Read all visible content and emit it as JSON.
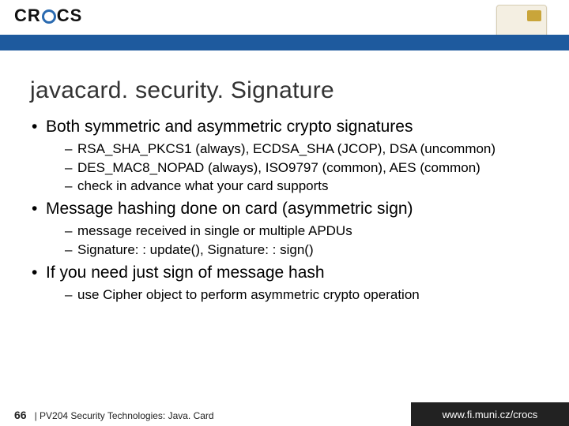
{
  "logo": {
    "text_before": "CR",
    "text_after": "CS"
  },
  "title": "javacard. security. Signature",
  "bullets": [
    {
      "text": "Both symmetric and asymmetric crypto signatures",
      "sub": [
        "RSA_SHA_PKCS1 (always), ECDSA_SHA (JCOP), DSA (uncommon)",
        "DES_MAC8_NOPAD (always), ISO9797 (common), AES (common)",
        "check in advance what your card supports"
      ]
    },
    {
      "text": "Message hashing done on card (asymmetric sign)",
      "sub": [
        "message received in single or multiple APDUs",
        "Signature: : update(), Signature: : sign()"
      ]
    },
    {
      "text": "If you need just sign of message hash",
      "sub": [
        "use Cipher object to perform asymmetric crypto operation"
      ]
    }
  ],
  "footer": {
    "slide_number": "66",
    "course": "| PV204 Security Technologies: Java. Card",
    "site": "www.fi.muni.cz/crocs"
  }
}
